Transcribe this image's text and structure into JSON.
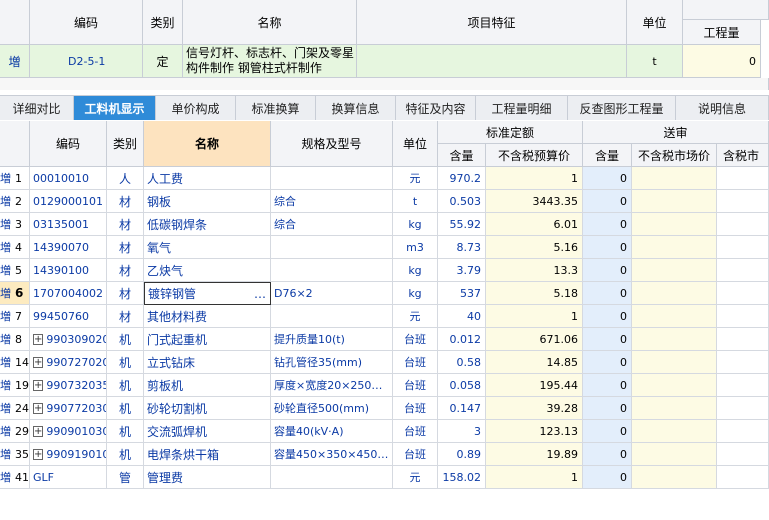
{
  "top_table": {
    "headers": {
      "code": "编码",
      "type": "类别",
      "name": "名称",
      "feature": "项目特征",
      "unit": "单位",
      "qty": "工程量"
    },
    "row": {
      "marker": "増",
      "code": "D2-5-1",
      "type": "定",
      "name_line1": "信号灯杆、标志杆、门架及零星",
      "name_line2": "构件制作 钢管柱式杆制作",
      "unit": "t",
      "qty": "0"
    }
  },
  "tabs": [
    {
      "label": "详细对比",
      "active": false
    },
    {
      "label": "工料机显示",
      "active": true
    },
    {
      "label": "单价构成",
      "active": false
    },
    {
      "label": "标准换算",
      "active": false
    },
    {
      "label": "换算信息",
      "active": false
    },
    {
      "label": "特征及内容",
      "active": false
    },
    {
      "label": "工程量明细",
      "active": false
    },
    {
      "label": "反查图形工程量",
      "active": false
    },
    {
      "label": "说明信息",
      "active": false
    }
  ],
  "grid": {
    "headers": {
      "code": "编码",
      "type": "类别",
      "name": "名称",
      "spec": "规格及型号",
      "unit": "单位",
      "standard_group": "标准定额",
      "std_qty": "含量",
      "std_price": "不含税预算价",
      "review_group": "送审",
      "rev_qty": "含量",
      "rev_market": "不含税市场价",
      "rev_tax": "含税市"
    },
    "rows": [
      {
        "marker": "増",
        "no": "1",
        "code": "00010010",
        "type": "人",
        "name": "人工费",
        "spec": "",
        "unit": "元",
        "qty": "970.2",
        "price": "1",
        "rev_qty": "0",
        "expand": false,
        "selected": false
      },
      {
        "marker": "増",
        "no": "2",
        "code": "0129000101",
        "type": "材",
        "name": "钢板",
        "spec": "综合",
        "unit": "t",
        "qty": "0.503",
        "price": "3443.35",
        "rev_qty": "0",
        "expand": false,
        "selected": false
      },
      {
        "marker": "増",
        "no": "3",
        "code": "03135001",
        "type": "材",
        "name": "低碳钢焊条",
        "spec": "综合",
        "unit": "kg",
        "qty": "55.92",
        "price": "6.01",
        "rev_qty": "0",
        "expand": false,
        "selected": false
      },
      {
        "marker": "増",
        "no": "4",
        "code": "14390070",
        "type": "材",
        "name": "氧气",
        "spec": "",
        "unit": "m3",
        "qty": "8.73",
        "price": "5.16",
        "rev_qty": "0",
        "expand": false,
        "selected": false
      },
      {
        "marker": "増",
        "no": "5",
        "code": "14390100",
        "type": "材",
        "name": "乙炔气",
        "spec": "",
        "unit": "kg",
        "qty": "3.79",
        "price": "13.3",
        "rev_qty": "0",
        "expand": false,
        "selected": false
      },
      {
        "marker": "増",
        "no": "6",
        "code": "1707004002",
        "type": "材",
        "name": "镀锌钢管",
        "spec": "D76×2",
        "unit": "kg",
        "qty": "537",
        "price": "5.18",
        "rev_qty": "0",
        "expand": false,
        "selected": true
      },
      {
        "marker": "増",
        "no": "7",
        "code": "99450760",
        "type": "材",
        "name": "其他材料费",
        "spec": "",
        "unit": "元",
        "qty": "40",
        "price": "1",
        "rev_qty": "0",
        "expand": false,
        "selected": false
      },
      {
        "marker": "増",
        "no": "8",
        "code": "990309020",
        "type": "机",
        "name": "门式起重机",
        "spec": "提升质量10(t)",
        "unit": "台班",
        "qty": "0.012",
        "price": "671.06",
        "rev_qty": "0",
        "expand": true,
        "selected": false
      },
      {
        "marker": "増",
        "no": "14",
        "code": "990727020",
        "type": "机",
        "name": "立式钻床",
        "spec": "钻孔管径35(mm)",
        "unit": "台班",
        "qty": "0.58",
        "price": "14.85",
        "rev_qty": "0",
        "expand": true,
        "selected": false
      },
      {
        "marker": "増",
        "no": "19",
        "code": "990732035",
        "type": "机",
        "name": "剪板机",
        "spec": "厚度×宽度20×250…",
        "unit": "台班",
        "qty": "0.058",
        "price": "195.44",
        "rev_qty": "0",
        "expand": true,
        "selected": false
      },
      {
        "marker": "増",
        "no": "24",
        "code": "990772030",
        "type": "机",
        "name": "砂轮切割机",
        "spec": "砂轮直径500(mm)",
        "unit": "台班",
        "qty": "0.147",
        "price": "39.28",
        "rev_qty": "0",
        "expand": true,
        "selected": false
      },
      {
        "marker": "増",
        "no": "29",
        "code": "990901030",
        "type": "机",
        "name": "交流弧焊机",
        "spec": "容量40(kV·A)",
        "unit": "台班",
        "qty": "3",
        "price": "123.13",
        "rev_qty": "0",
        "expand": true,
        "selected": false
      },
      {
        "marker": "増",
        "no": "35",
        "code": "990919010",
        "type": "机",
        "name": "电焊条烘干箱",
        "spec": "容量450×350×450…",
        "unit": "台班",
        "qty": "0.89",
        "price": "19.89",
        "rev_qty": "0",
        "expand": true,
        "selected": false
      },
      {
        "marker": "増",
        "no": "41",
        "code": "GLF",
        "type": "管",
        "name": "管理费",
        "spec": "",
        "unit": "元",
        "qty": "158.02",
        "price": "1",
        "rev_qty": "0",
        "expand": false,
        "selected": false
      }
    ],
    "ellipsis": "…"
  }
}
